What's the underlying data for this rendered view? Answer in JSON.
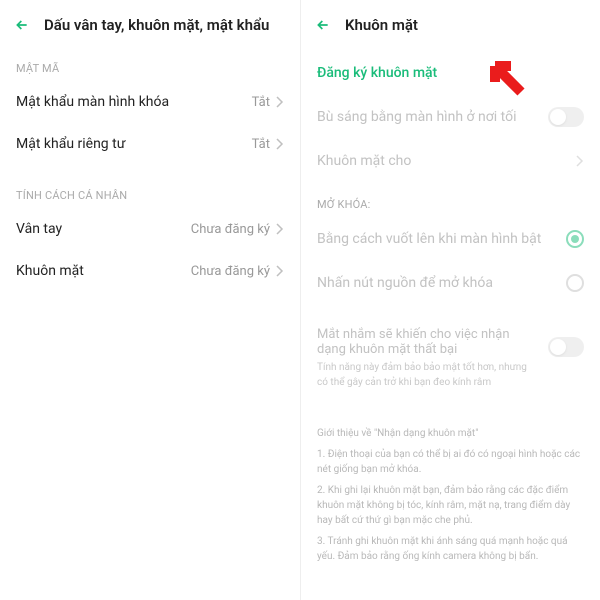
{
  "left": {
    "title": "Dấu vân tay, khuôn mặt, mật khẩu",
    "section1": "MẬT MÃ",
    "row1": {
      "label": "Mật khẩu màn hình khóa",
      "value": "Tắt"
    },
    "row2": {
      "label": "Mật khẩu riêng tư",
      "value": "Tắt"
    },
    "section2": "TÍNH CÁCH CÁ NHÂN",
    "row3": {
      "label": "Vân tay",
      "value": "Chưa đăng ký"
    },
    "row4": {
      "label": "Khuôn mặt",
      "value": "Chưa đăng ký"
    }
  },
  "right": {
    "title": "Khuôn mặt",
    "row1": "Đăng ký khuôn mặt",
    "row2": "Bù sáng bằng màn hình ở nơi tối",
    "row3": "Khuôn mặt cho",
    "section1": "MỞ KHÓA:",
    "row4": "Bằng cách vuốt lên khi màn hình bật",
    "row5": "Nhấn nút nguồn để mở khóa",
    "info_title": "Mắt nhắm sẽ khiến cho việc nhận dạng khuôn mặt thất bại",
    "info_desc": "Tính năng này đảm bảo bảo mật tốt hơn, nhưng có thể gây cản trở khi bạn đeo kính râm",
    "footer_intro": "Giới thiệu về \"Nhận dạng khuôn mặt\"",
    "footer_p1": "1. Điện thoại của bạn có thể bị ai đó có ngoại hình hoặc các nét giống bạn mở khóa.",
    "footer_p2": "2. Khi ghi lại khuôn mặt bạn, đảm bảo rằng các đặc điểm khuôn mặt không bị tóc, kính râm, mặt nạ, trang điểm dày hay bất cứ thứ gì bạn mặc che phủ.",
    "footer_p3": "3. Tránh ghi khuôn mặt khi ánh sáng quá mạnh hoặc quá yếu. Đảm bảo rằng ống kính camera không bị bẩn."
  }
}
